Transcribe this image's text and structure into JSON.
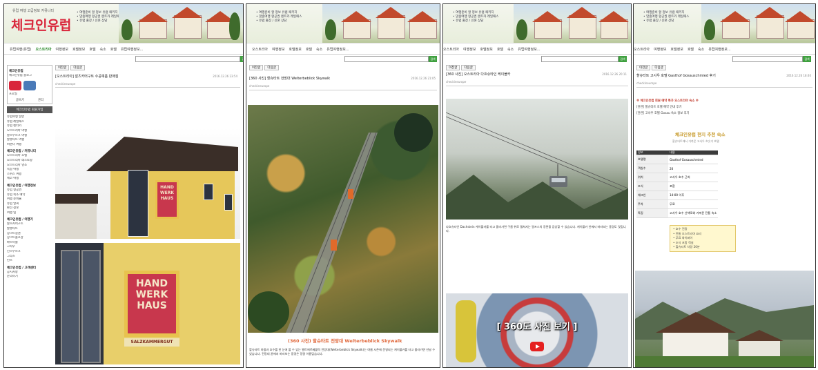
{
  "site": {
    "logo": "체크인유럽",
    "logo_sub": "유럽 여행 고급정보 커뮤니티",
    "ad_lines": [
      "• 여행준비 할 정보 유럽 패키지",
      "• 맞춤여행 항공권 렌트카 레일패스",
      "• 유럽 출장 / 신혼 상담"
    ],
    "menu": [
      "유럽여행(유럽)",
      "오스트리아",
      "여행정보",
      "호텔정보",
      "호텔",
      "숙소",
      "호텔",
      "유럽여행정보..."
    ],
    "search_btn": "검색"
  },
  "tabs": [
    "이전글",
    "다음글"
  ],
  "panel1": {
    "title": "[오스트리아] 잘츠카머구트 수공예품 판매점",
    "meta": "2016.12.26 23:54",
    "author": "checkineurope",
    "sidebar": {
      "blog_title": "체크인유럽",
      "blog_sub": "체크인유럽 블로그",
      "profile_label": "프로필",
      "btn1": "글쓰기",
      "btn2": "관리",
      "btn3": "체크인유럽 회원가입",
      "group1": [
        "유럽여행 일반",
        "유럽 레일패스",
        "유럽 렌터카",
        "오스트리아 여행",
        "잘츠부르크 여행",
        "할슈타트 여행",
        "비엔나 여행"
      ],
      "group2_title": "체크인유럽 / 커뮤니티",
      "group2": [
        "오스트리아 호텔",
        "오스트리아 레스토랑",
        "오스트리아 명소",
        "독일 여행",
        "스위스 여행",
        "체코 여행"
      ],
      "group3_title": "체크인유럽 / 여행정보",
      "group3": [
        "유럽 항공권",
        "유럽 숙소 예약",
        "여행 준비물",
        "유럽 날씨",
        "환전 정보",
        "여행 팁"
      ],
      "group4_title": "체크인유럽 / 여행기",
      "group4": [
        "잘츠카머구트",
        "할슈타트",
        "장크트길겐",
        "장크트볼프강",
        "바트이슐",
        "고사우",
        "인스부르크",
        "그라츠",
        "린츠"
      ],
      "group5_title": "체크인유럽 / 고객센터",
      "group5": [
        "공지사항",
        "문의하기"
      ]
    },
    "sign": {
      "line1": "HAND",
      "line2": "WERK",
      "line3": "HAUS",
      "brand": "SALZKAMMERGUT"
    }
  },
  "panel2": {
    "title": "[360 사진] 할슈타트 전망대 Welterbeblick Skywalk",
    "meta": "2016.12.26 21:05",
    "author": "checkineurope",
    "caption": "(360 사진) 할슈타트 전망대 Welterbeblick Skywalk",
    "para": "할슈타트 마을과 호수를 한 눈에 볼 수 있는 벨트에르베블릭 전망대(Welterbeblick Skywalk)는 여름 시즌에 운영되는 케이블카를 타고 올라가면 만날 수 있습니다. 전망대 끝에서 바라보는 풍경은 정말 아름답습니다."
  },
  "panel3": {
    "title": "[360 사진] 오스트리아 다흐슈타인 케이블카",
    "meta": "2016.12.26 20:11",
    "author": "checkineurope",
    "para": "다흐슈타인 Dachstein 케이블카를 타고 올라가면 구름 위로 펼쳐지는 알프스의 장관을 감상할 수 있습니다. 케이블카 안에서 바라보는 풍경도 멋집니다.",
    "vr_label": "[ 360도 사진 보기 ]"
  },
  "panel4": {
    "title": "할슈타트 고사우 호텔 Gasthof Gosauschmied 후기",
    "meta": "2016.12.26 18:40",
    "author": "checkineurope",
    "red_note": "※ 체크인유럽 회원 예약 특가 오스트리아 숙소 ※",
    "links": [
      "[관련] 할슈타트 호텔 예약 안내 후기",
      "[관련] 고사우 호텔 Gosau 숙소 정보 후기"
    ],
    "hero_title": "체크인유럽 현지 추천 숙소",
    "hero_sub": "할슈타트에서 가까운 고사우 호숫가 호텔",
    "table": {
      "head": [
        "정보",
        "내용"
      ],
      "rows": [
        [
          "호텔명",
          "Gasthof Gosauschmied"
        ],
        [
          "객실수",
          "20"
        ],
        [
          "위치",
          "고사우 호수 근처"
        ],
        [
          "조식",
          "포함"
        ],
        [
          "체크인",
          "14:00 이후"
        ],
        [
          "주차",
          "무료"
        ],
        [
          "특징",
          "고사우 호수 산책로와 가까운 전통 숙소"
        ]
      ]
    },
    "yellow_box": [
      "• 호수 전망",
      "• 전통 오스트리아 요리",
      "• 무료 와이파이",
      "• 조식 포함 객실",
      "• 할슈타트 차량 20분"
    ]
  }
}
